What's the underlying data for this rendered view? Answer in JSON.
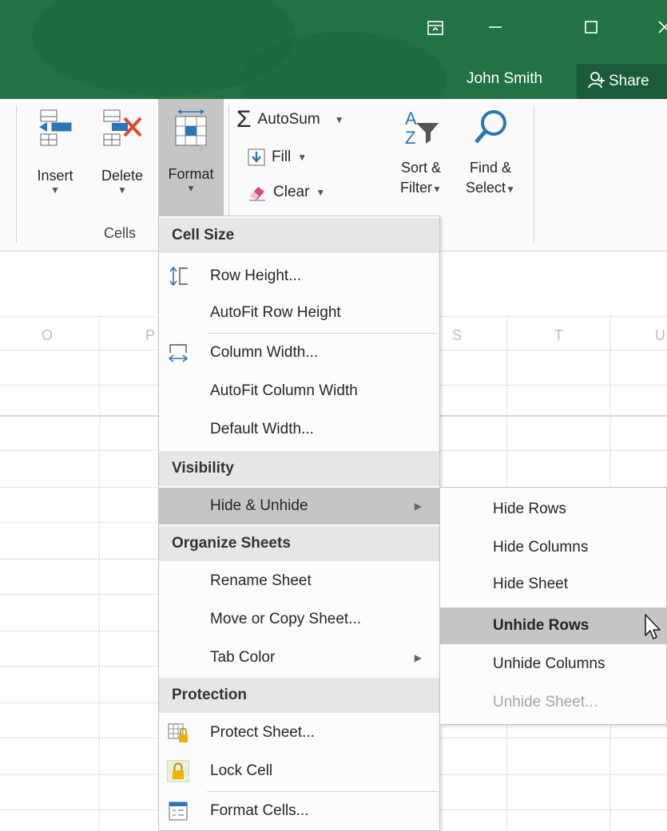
{
  "titlebar": {
    "user_name": "John Smith",
    "share_label": "Share",
    "ribbon_display_icon": "ribbon-display-icon",
    "minimize_icon": "minimize-icon",
    "maximize_icon": "maximize-icon",
    "close_icon": "close-icon"
  },
  "ribbon": {
    "insert_label": "Insert",
    "delete_label": "Delete",
    "format_label": "Format",
    "cells_group_label": "Cells",
    "autosum_label": "AutoSum",
    "fill_label": "Fill",
    "clear_label": "Clear",
    "sort_label_1": "Sort &",
    "sort_label_2": "Filter",
    "find_label_1": "Find &",
    "find_label_2": "Select"
  },
  "grid": {
    "columns": [
      "O",
      "P",
      "S",
      "T",
      "U"
    ]
  },
  "format_menu": {
    "section_cell_size": "Cell Size",
    "row_height": "Row Height...",
    "autofit_row_height": "AutoFit Row Height",
    "column_width": "Column Width...",
    "autofit_column_width": "AutoFit Column Width",
    "default_width": "Default Width...",
    "section_visibility": "Visibility",
    "hide_unhide": "Hide & Unhide",
    "section_organize": "Organize Sheets",
    "rename_sheet": "Rename Sheet",
    "move_copy_sheet": "Move or Copy Sheet...",
    "tab_color": "Tab Color",
    "section_protection": "Protection",
    "protect_sheet": "Protect Sheet...",
    "lock_cell": "Lock Cell",
    "format_cells": "Format Cells..."
  },
  "hide_unhide_menu": {
    "hide_rows": "Hide Rows",
    "hide_columns": "Hide Columns",
    "hide_sheet": "Hide Sheet",
    "unhide_rows": "Unhide Rows",
    "unhide_columns": "Unhide Columns",
    "unhide_sheet": "Unhide Sheet..."
  },
  "colors": {
    "excel_green": "#217346",
    "highlight": "#c5c5c5",
    "section_bg": "#e6e6e6"
  }
}
